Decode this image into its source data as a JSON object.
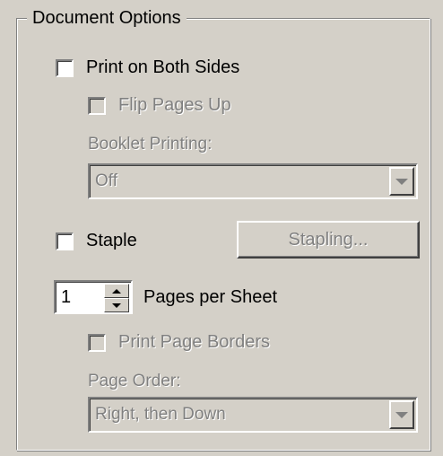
{
  "group": {
    "title": "Document Options"
  },
  "print_both_sides": {
    "label": "Print on Both Sides",
    "checked": false
  },
  "flip_pages_up": {
    "label": "Flip Pages Up",
    "checked": false,
    "disabled": true
  },
  "booklet": {
    "label": "Booklet Printing:",
    "value": "Off"
  },
  "staple": {
    "label": "Staple",
    "checked": false
  },
  "stapling_button": {
    "label": "Stapling..."
  },
  "pages_per_sheet": {
    "value": "1",
    "label": "Pages per Sheet"
  },
  "print_page_borders": {
    "label": "Print Page Borders",
    "checked": false,
    "disabled": true
  },
  "page_order": {
    "label": "Page Order:",
    "value": "Right, then Down"
  }
}
